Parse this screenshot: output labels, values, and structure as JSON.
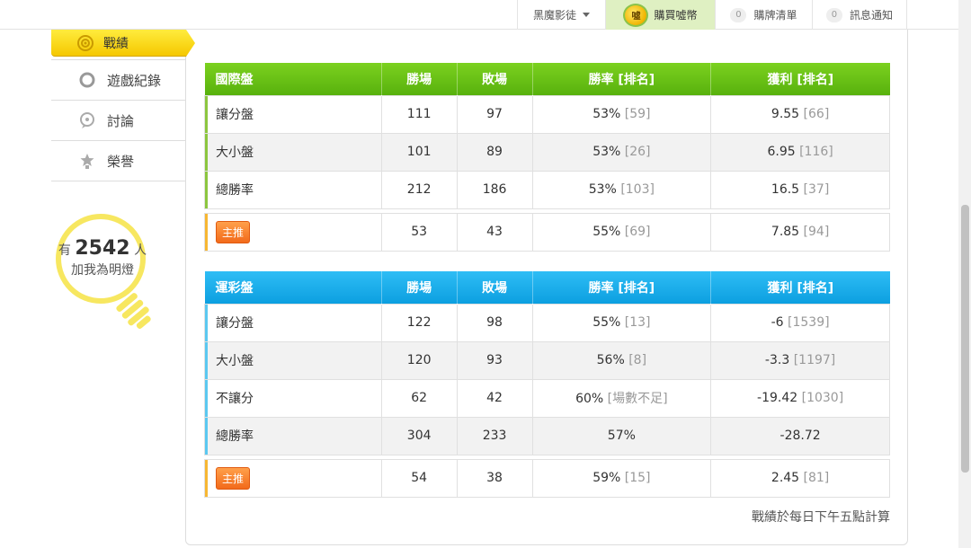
{
  "topbar": {
    "user_name": "黑魔影徒",
    "buy_label": "購買噓幣",
    "coin_glyph": "噓",
    "cart_count": "0",
    "cart_label": "購牌清單",
    "notify_count": "0",
    "notify_label": "訊息通知"
  },
  "sidebar": {
    "active_label": "戰績",
    "items": [
      {
        "label": "遊戲紀錄",
        "icon": "circle-icon"
      },
      {
        "label": "討論",
        "icon": "chat-icon"
      },
      {
        "label": "榮譽",
        "icon": "medal-icon"
      }
    ],
    "bulb": {
      "prefix": "有",
      "count": "2542",
      "suffix": "人",
      "line2": "加我為明燈"
    }
  },
  "intl_table": {
    "headers": [
      "國際盤",
      "勝場",
      "敗場",
      "勝率 [排名]",
      "獲利 [排名]"
    ],
    "rows": [
      {
        "name": "讓分盤",
        "wins": "111",
        "losses": "97",
        "rate": "53%",
        "rate_rank": "[59]",
        "profit": "9.55",
        "profit_rank": "[66]"
      },
      {
        "name": "大小盤",
        "wins": "101",
        "losses": "89",
        "rate": "53%",
        "rate_rank": "[26]",
        "profit": "6.95",
        "profit_rank": "[116]"
      },
      {
        "name": "總勝率",
        "wins": "212",
        "losses": "186",
        "rate": "53%",
        "rate_rank": "[103]",
        "profit": "16.5",
        "profit_rank": "[37]"
      }
    ],
    "promo": {
      "badge": "主推",
      "wins": "53",
      "losses": "43",
      "rate": "55%",
      "rate_rank": "[69]",
      "profit": "7.85",
      "profit_rank": "[94]"
    }
  },
  "lottery_table": {
    "headers": [
      "運彩盤",
      "勝場",
      "敗場",
      "勝率 [排名]",
      "獲利 [排名]"
    ],
    "rows": [
      {
        "name": "讓分盤",
        "wins": "122",
        "losses": "98",
        "rate": "55%",
        "rate_rank": "[13]",
        "profit": "-6",
        "profit_rank": "[1539]"
      },
      {
        "name": "大小盤",
        "wins": "120",
        "losses": "93",
        "rate": "56%",
        "rate_rank": "[8]",
        "profit": "-3.3",
        "profit_rank": "[1197]"
      },
      {
        "name": "不讓分",
        "wins": "62",
        "losses": "42",
        "rate": "60%",
        "rate_rank": "[場數不足]",
        "profit": "-19.42",
        "profit_rank": "[1030]"
      },
      {
        "name": "總勝率",
        "wins": "304",
        "losses": "233",
        "rate": "57%",
        "rate_rank": "",
        "profit": "-28.72",
        "profit_rank": ""
      }
    ],
    "promo": {
      "badge": "主推",
      "wins": "54",
      "losses": "38",
      "rate": "59%",
      "rate_rank": "[15]",
      "profit": "2.45",
      "profit_rank": "[81]"
    }
  },
  "footnote": "戰績於每日下午五點計算",
  "colors": {
    "green_header": "#6cc318",
    "blue_header": "#1aaeea",
    "active_tab": "#f8d81a",
    "promo": "#f27a22"
  }
}
